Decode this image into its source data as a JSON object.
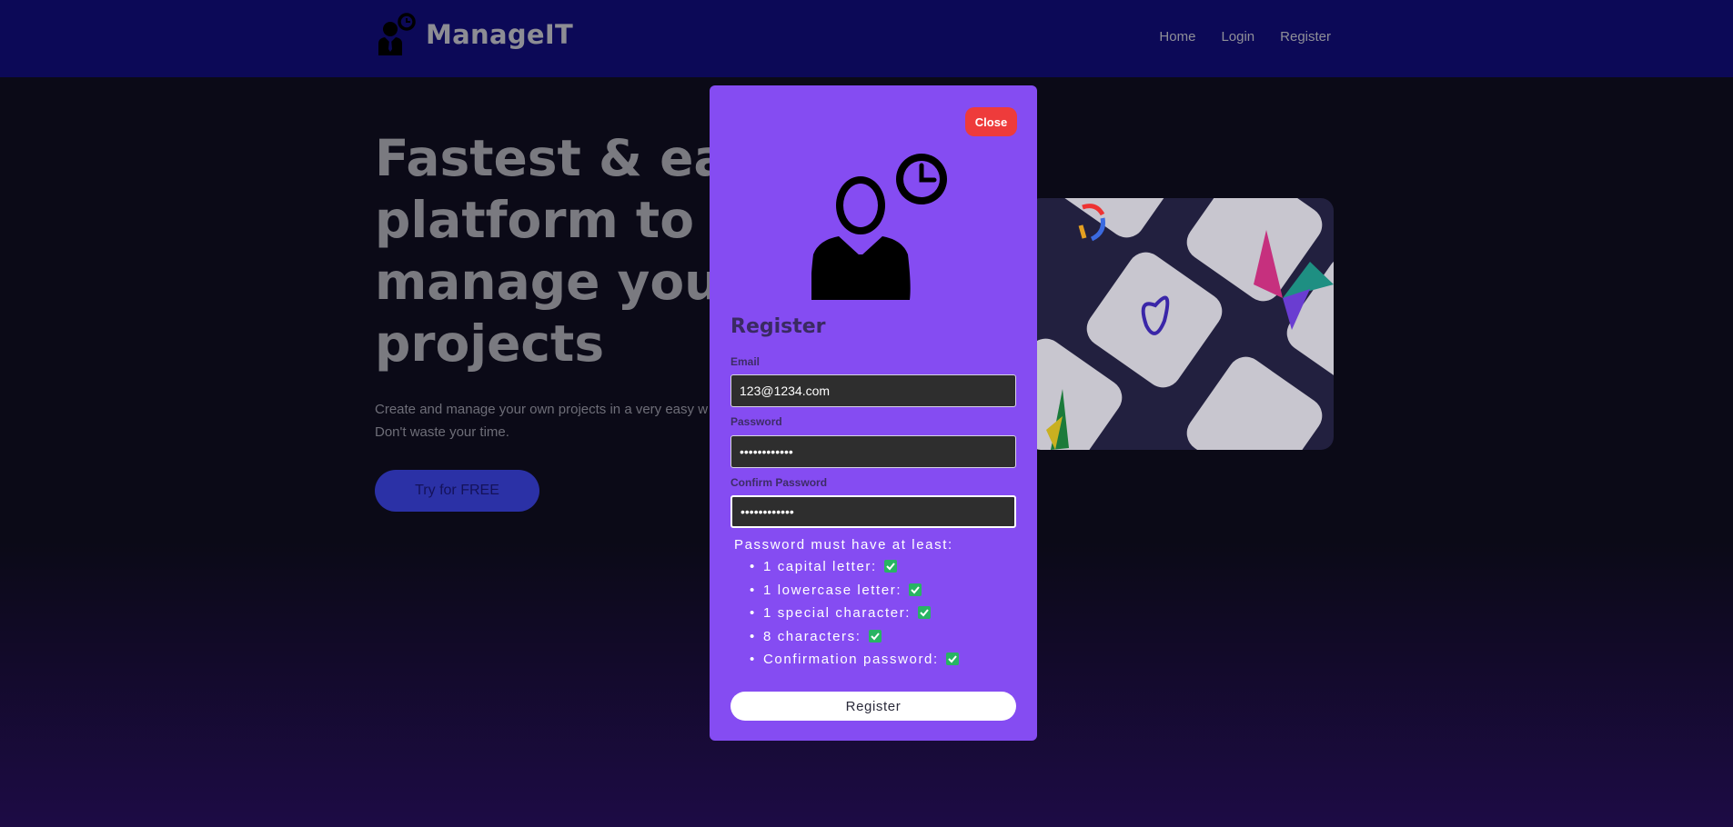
{
  "header": {
    "brand_name": "ManageIT",
    "logo_icon": "manager-clock-icon",
    "nav": [
      "Home",
      "Login",
      "Register"
    ]
  },
  "hero": {
    "title_lines": [
      "Fastest & eas",
      "platform to",
      "manage your",
      "projects"
    ],
    "subtitle_lines": [
      "Create and manage your own projects in a very easy w",
      "Don't waste your time."
    ],
    "cta_label": "Try for FREE"
  },
  "modal": {
    "close_label": "Close",
    "icon": "manager-clock-icon",
    "title": "Register",
    "email": {
      "label": "Email",
      "value": "123@1234.com"
    },
    "password": {
      "label": "Password",
      "value": "••••••••••••"
    },
    "confirm_password": {
      "label": "Confirm Password",
      "value": "••••••••••••"
    },
    "rules_title": "Password must have at least:",
    "rules": [
      "1 capital letter:",
      "1 lowercase letter:",
      "1 special character:",
      "8 characters:",
      "Confirmation password:"
    ],
    "rule_status_icon": "check-icon",
    "submit_label": "Register"
  },
  "colors": {
    "navbar": "#0c0957",
    "modal": "#854cf2",
    "close": "#ee3b3b",
    "check": "#28b463"
  }
}
